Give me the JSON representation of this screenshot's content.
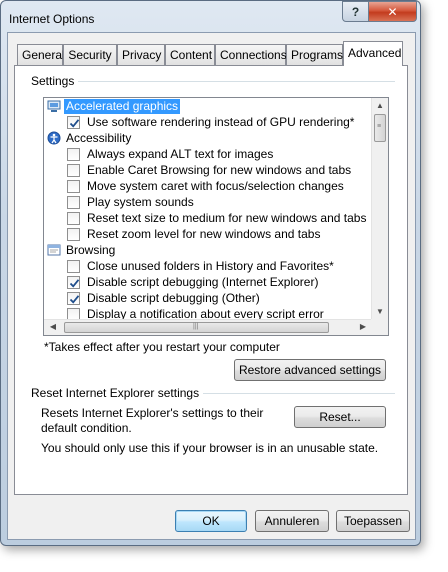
{
  "window": {
    "title": "Internet Options",
    "help_label": "?",
    "close_label": "✕"
  },
  "tabs": [
    {
      "label": "General"
    },
    {
      "label": "Security"
    },
    {
      "label": "Privacy"
    },
    {
      "label": "Content"
    },
    {
      "label": "Connections"
    },
    {
      "label": "Programs"
    },
    {
      "label": "Advanced"
    }
  ],
  "settings": {
    "group_label": "Settings",
    "rows": [
      {
        "kind": "category",
        "icon": "monitor-icon",
        "label": "Accelerated graphics",
        "selected": true
      },
      {
        "kind": "option",
        "checked": true,
        "label": "Use software rendering instead of GPU rendering*"
      },
      {
        "kind": "category",
        "icon": "accessibility-icon",
        "label": "Accessibility"
      },
      {
        "kind": "option",
        "checked": false,
        "label": "Always expand ALT text for images"
      },
      {
        "kind": "option",
        "checked": false,
        "label": "Enable Caret Browsing for new windows and tabs"
      },
      {
        "kind": "option",
        "checked": false,
        "label": "Move system caret with focus/selection changes"
      },
      {
        "kind": "option",
        "checked": false,
        "label": "Play system sounds"
      },
      {
        "kind": "option",
        "checked": false,
        "label": "Reset text size to medium for new windows and tabs"
      },
      {
        "kind": "option",
        "checked": false,
        "label": "Reset zoom level for new windows and tabs"
      },
      {
        "kind": "category",
        "icon": "browser-window-icon",
        "label": "Browsing"
      },
      {
        "kind": "option",
        "checked": false,
        "label": "Close unused folders in History and Favorites*"
      },
      {
        "kind": "option",
        "checked": true,
        "label": "Disable script debugging (Internet Explorer)"
      },
      {
        "kind": "option",
        "checked": true,
        "label": "Disable script debugging (Other)"
      },
      {
        "kind": "option",
        "checked": false,
        "label": "Display a notification about every script error"
      }
    ],
    "footnote": "*Takes effect after you restart your computer",
    "restore_label": "Restore advanced settings"
  },
  "reset": {
    "group_label": "Reset Internet Explorer settings",
    "description": "Resets Internet Explorer's settings to their default condition.",
    "reset_label": "Reset...",
    "warning": "You should only use this if your browser is in an unusable state."
  },
  "footer": {
    "ok_label": "OK",
    "cancel_label": "Annuleren",
    "apply_label": "Toepassen"
  },
  "colors": {
    "selection": "#3399ff",
    "check": "#1f4e8c"
  }
}
